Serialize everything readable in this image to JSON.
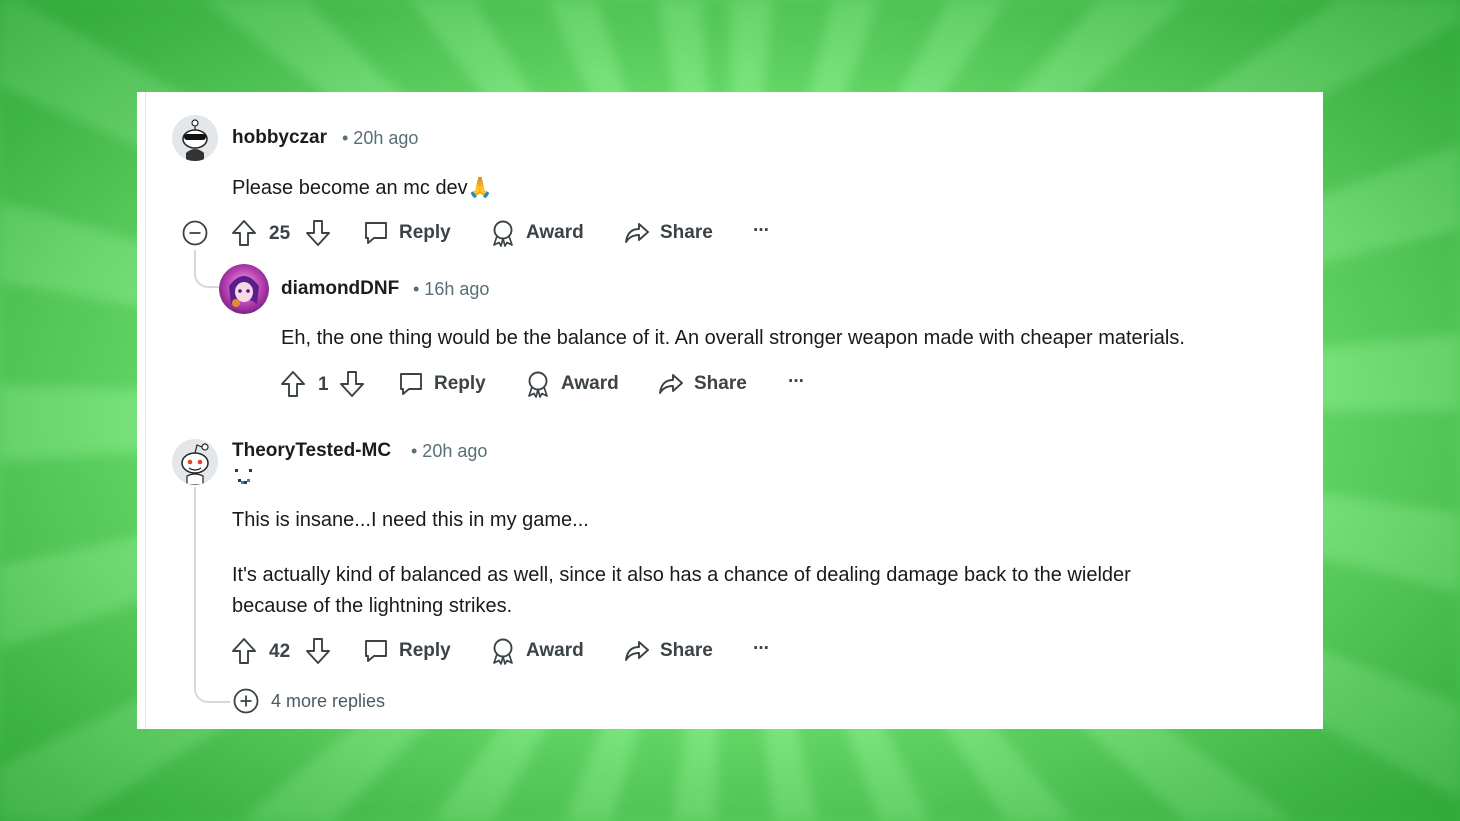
{
  "comments": [
    {
      "username": "hobbyczar",
      "time": "• 20h ago",
      "text": "Please become an mc dev🙏",
      "votes": "25"
    },
    {
      "username": "diamondDNF",
      "time": "• 16h ago",
      "text": "Eh, the one thing would be the balance of it. An overall stronger weapon made with cheaper materials.",
      "votes": "1"
    },
    {
      "username": "TheoryTested-MC",
      "time": "• 20h ago",
      "text_line1": "This is insane...I need this in my game...",
      "text_line2a": "It's actually kind of balanced as well, since it also has a chance of dealing damage back to the wielder",
      "text_line2b": "because of the lightning strikes.",
      "votes": "42"
    }
  ],
  "actions": {
    "reply": "Reply",
    "award": "Award",
    "share": "Share",
    "more": "···"
  },
  "more_replies": "4 more replies",
  "colors": {
    "background": "#7cf07e",
    "card": "#ffffff",
    "text": "#1a1a1b",
    "meta": "#576f76"
  }
}
